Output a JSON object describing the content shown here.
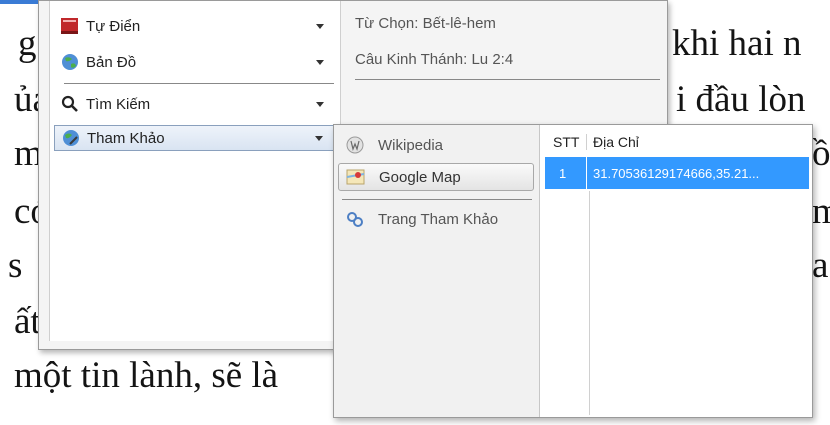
{
  "background_text": {
    "lines": [
      "g",
      "ủa",
      "m",
      "có",
      " s",
      "ất",
      "một tin lành, sẽ là",
      "khi hai n",
      "i đầu lòn",
      "ồ",
      "m",
      "a"
    ]
  },
  "menu": {
    "items": [
      {
        "label": "Tự Điển",
        "icon": "book-icon"
      },
      {
        "label": "Bản Đồ",
        "icon": "globe-icon"
      },
      {
        "label": "Tìm Kiếm",
        "icon": "search-icon"
      },
      {
        "label": "Tham Khảo",
        "icon": "globe-link-icon"
      }
    ]
  },
  "info": {
    "selected_word": "Từ Chọn: Bết-lê-hem",
    "verse": "Câu Kinh Thánh: Lu 2:4"
  },
  "submenu": {
    "items": [
      {
        "label": "Wikipedia",
        "icon": "wikipedia-icon"
      },
      {
        "label": "Google Map",
        "icon": "map-icon"
      },
      {
        "label": "Trang Tham Khảo",
        "icon": "link-icon"
      }
    ]
  },
  "grid": {
    "columns": [
      "STT",
      "Địa Chỉ"
    ],
    "rows": [
      {
        "stt": "1",
        "address": "31.70536129174666,35.21..."
      }
    ]
  },
  "colors": {
    "selection": "#3399ff",
    "panel": "#f4f4f4"
  }
}
